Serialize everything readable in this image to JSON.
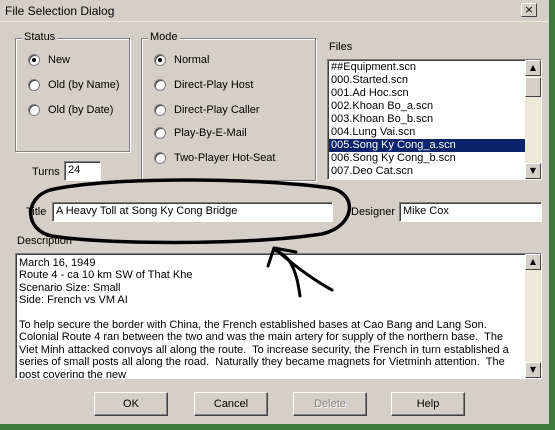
{
  "window": {
    "title": "File Selection Dialog",
    "close_glyph": "×"
  },
  "status": {
    "label": "Status",
    "options": [
      {
        "label": "New",
        "checked": true
      },
      {
        "label": "Old (by Name)",
        "checked": false
      },
      {
        "label": "Old (by Date)",
        "checked": false
      }
    ]
  },
  "mode": {
    "label": "Mode",
    "options": [
      {
        "label": "Normal",
        "checked": true
      },
      {
        "label": "Direct-Play Host",
        "checked": false
      },
      {
        "label": "Direct-Play Caller",
        "checked": false
      },
      {
        "label": "Play-By-E-Mail",
        "checked": false
      },
      {
        "label": "Two-Player Hot-Seat",
        "checked": false
      }
    ]
  },
  "turns": {
    "label": "Turns",
    "value": "24"
  },
  "files": {
    "label": "Files",
    "items": [
      "##Equipment.scn",
      "000.Started.scn",
      "001.Ad Hoc.scn",
      "002.Khoan Bo_a.scn",
      "003.Khoan Bo_b.scn",
      "004.Lung Vai.scn",
      "005.Song Ky Cong_a.scn",
      "006.Song Ky Cong_b.scn",
      "007.Deo Cat.scn"
    ],
    "selected_index": 6
  },
  "title_field": {
    "label": "Title",
    "value": "A Heavy Toll at Song Ky Cong Bridge"
  },
  "designer_field": {
    "label": "Designer",
    "value": "Mike Cox"
  },
  "description": {
    "label": "Description",
    "text": "March 16, 1949\nRoute 4 - ca 10 km SW of That Khe\nScenario Size: Small\nSide: French vs VM AI\n\nTo help secure the border with China, the French established bases at Cao Bang and Lang Son.  Colonial Route 4 ran between the two and was the main artery for supply of the northern base.  The Viet Minh attacked convoys all along the route.  To increase security, the French in turn established a series of small posts all along the road.  Naturally they became magnets for Vietminh attention.  The post covering the new"
  },
  "buttons": {
    "ok": "OK",
    "cancel": "Cancel",
    "delete": "Delete",
    "help": "Help"
  },
  "icons": {
    "scroll_up": "▲",
    "scroll_down": "▼",
    "close": "close-icon"
  },
  "colors": {
    "dialog_face": "#d4d0c8",
    "selection": "#0a246a",
    "annotation_ink": "#000000"
  }
}
